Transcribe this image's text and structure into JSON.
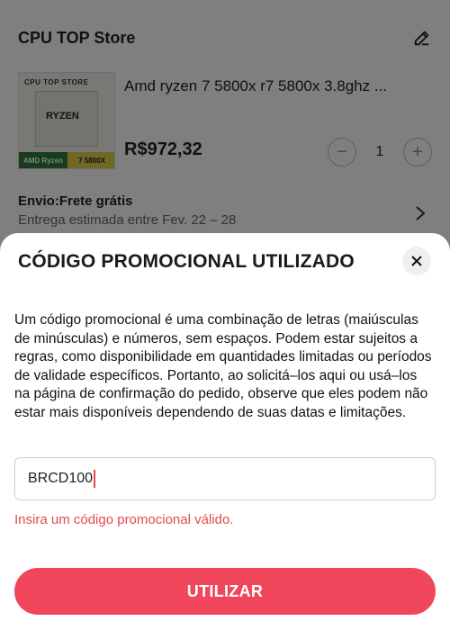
{
  "store": {
    "name": "CPU TOP Store"
  },
  "product": {
    "thumb_top_text": "CPU TOP STORE",
    "thumb_brand": "RYZEN",
    "thumb_left_label": "AMD Ryzen",
    "thumb_right_label": "7 5800X",
    "title": "Amd ryzen 7 5800x r7 5800x 3.8ghz ...",
    "price": "R$972,32",
    "quantity": "1",
    "minus": "−",
    "plus": "+"
  },
  "shipping": {
    "title": "Envio:Frete grátis",
    "estimate": "Entrega estimada entre Fev. 22 – 28"
  },
  "promo_sheet": {
    "title": "CÓDIGO PROMOCIONAL UTILIZADO",
    "description": "Um código promocional é uma combinação de letras (maiúsculas de minúsculas) e números, sem espaços. Podem estar sujeitos a regras, como disponibilidade em quantidades limitadas ou períodos de validade específicos. Portanto, ao solicitá–los aqui ou usá–los na página de confirmação do pedido, observe que eles podem não estar mais disponíveis dependendo de suas datas e limitações.",
    "input_value": "BRCD100",
    "error": "Insira um código promocional válido.",
    "apply_label": "UTILIZAR"
  },
  "colors": {
    "accent": "#f0465c",
    "error": "#e5484d",
    "overlay": "rgba(0,0,0,0.5)"
  },
  "icons": {
    "edit": "pencil-icon",
    "close": "close-icon",
    "chevron": "chevron-right-icon"
  }
}
